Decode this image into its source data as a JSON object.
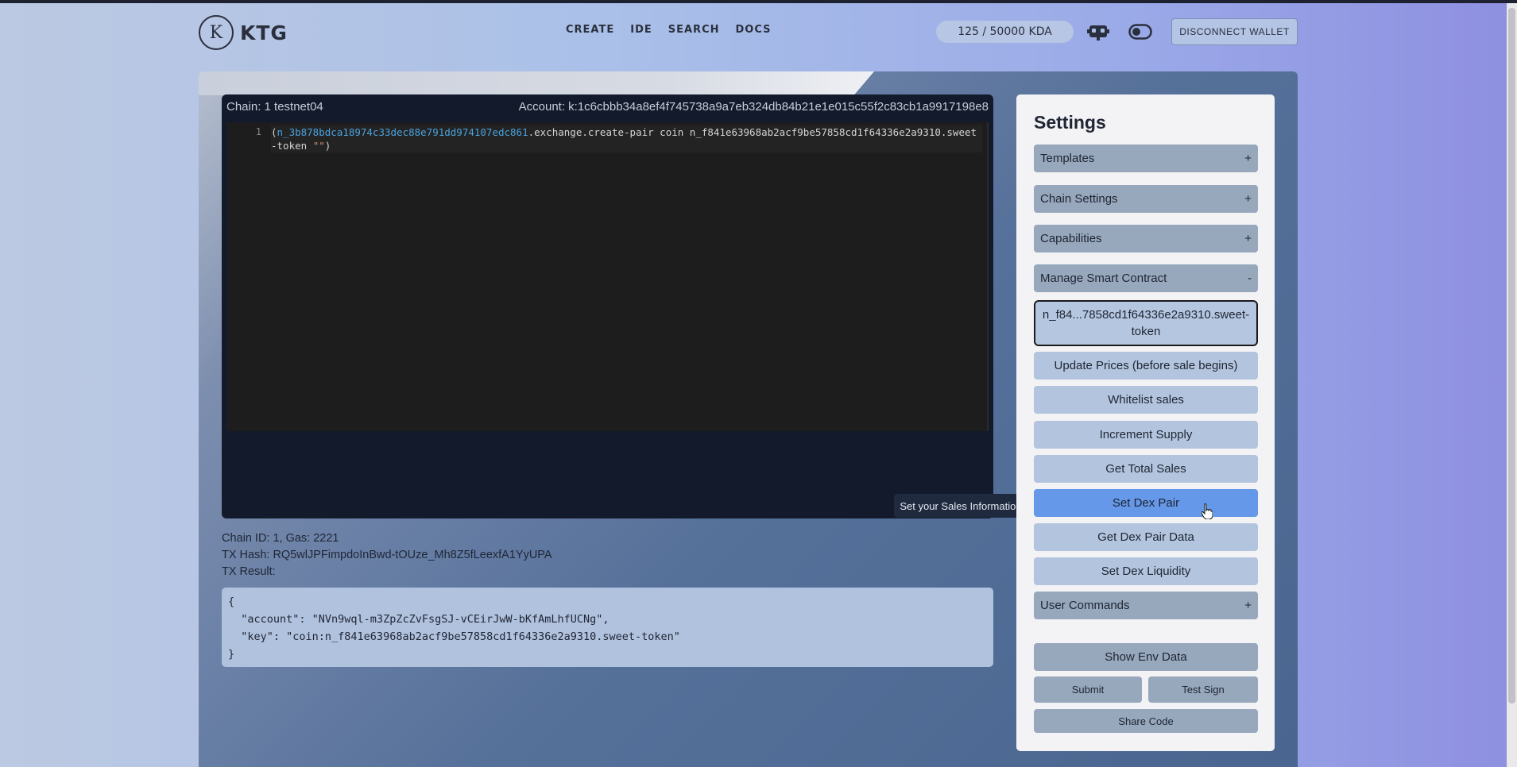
{
  "header": {
    "logo_letter": "K",
    "logo_text": "KTG",
    "nav": [
      "CREATE",
      "IDE",
      "SEARCH",
      "DOCS"
    ],
    "kda_balance": "125 / 50000 KDA",
    "disconnect_label": "DISCONNECT WALLET"
  },
  "editor": {
    "chain_label": "Chain: 1 testnet04",
    "account_label": "Account: k:1c6cbbb34a8ef4f745738a9a7eb324db84b21e1e015c55f2c83cb1a9917198e8",
    "line_number": "1",
    "code_namespace": "n_3b878bdca18974c33dec88e791dd974107edc861",
    "code_rest": ".exchange.create-pair coin n_f841e63968ab2acf9be57858cd1f64336e2a9310.sweet-token ",
    "code_string": "\"\"",
    "code_open": "(",
    "code_close": ")"
  },
  "tooltip": "Set your Sales Information",
  "tx": {
    "chain_gas": "Chain ID: 1, Gas: 2221",
    "hash": "TX Hash: RQ5wlJPFimpdoInBwd-tOUze_Mh8Z5fLeexfA1YyUPA",
    "result_label": "TX Result:",
    "result_json": "{\n  \"account\": \"NVn9wql-m3ZpZcZvFsgSJ-vCEirJwW-bKfAmLhfUCNg\",\n  \"key\": \"coin:n_f841e63968ab2acf9be57858cd1f64336e2a9310.sweet-token\"\n}"
  },
  "settings": {
    "title": "Settings",
    "accordions": [
      {
        "label": "Templates",
        "sign": "+"
      },
      {
        "label": "Chain Settings",
        "sign": "+"
      },
      {
        "label": "Capabilities",
        "sign": "+"
      },
      {
        "label": "Manage Smart Contract",
        "sign": "-"
      }
    ],
    "contract": "n_f84...7858cd1f64336e2a9310.sweet-token",
    "actions": [
      "Update Prices (before sale begins)",
      "Whitelist sales",
      "Increment Supply",
      "Get Total Sales",
      "Set Dex Pair",
      "Get Dex Pair Data",
      "Set Dex Liquidity"
    ],
    "active_action": "Set Dex Pair",
    "user_commands": {
      "label": "User Commands",
      "sign": "+"
    },
    "show_env": "Show Env Data",
    "submit": "Submit",
    "test_sign": "Test Sign",
    "share_code": "Share Code"
  }
}
